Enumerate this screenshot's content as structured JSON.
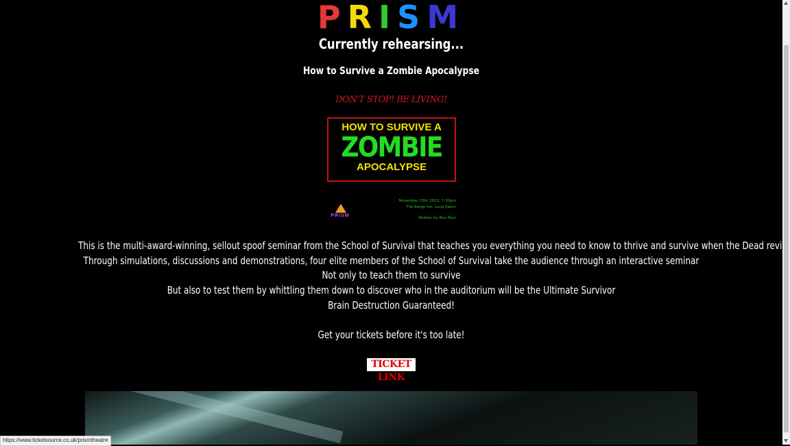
{
  "logo": {
    "letters": [
      "P",
      "R",
      "I",
      "S",
      "M"
    ]
  },
  "heading": "Currently rehearsing...",
  "subheading": "How to Survive a Zombie Apocalypse",
  "tagline": "DON'T STOP! BE LIVING!",
  "poster": {
    "line1": "HOW TO SURVIVE A",
    "line2": "ZOMBIE",
    "line3": "APOCALYPSE"
  },
  "mini_logo_text": "PRISM",
  "event_info": {
    "date": "November 25th 2023, 7:30pm",
    "venue": "The Barge Inn, Long Eaton",
    "author": "Written by Ben Muir"
  },
  "body_lines": [
    "This is the multi-award-winning, sellout spoof seminar from the School of Survival that teaches you everything you need to know to thrive and survive when the Dead revive ...",
    "Through simulations, discussions and demonstrations, four elite members of the School of Survival take the audience through an interactive seminar",
    "Not only to teach them to survive",
    "But also to test them by whittling them down to discover who in the auditorium will be the Ultimate Survivor",
    "Brain Destruction Guaranteed!",
    "",
    "Get your tickets before it's too late!"
  ],
  "ticket_button": "TICKET LINK",
  "status_url": "https://www.ticketsource.co.uk/prismtheatre",
  "colors": {
    "background": "#000000",
    "tagline": "#d21a1a",
    "poster_border": "#c41414",
    "poster_yellow": "#f5e200",
    "poster_green": "#22dd22",
    "event_info": "#22c822",
    "ticket_text": "#e00000"
  }
}
